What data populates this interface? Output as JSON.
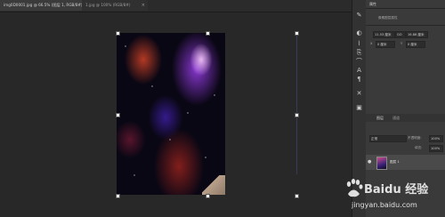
{
  "tabs": [
    {
      "label": "img0D0001.jpg @ 66.5% (图层 1, RGB/8#)",
      "close": "×"
    },
    {
      "label": "1.jpg @ 100% (RGB/8#)",
      "close": "×"
    }
  ],
  "properties": {
    "tab_label": "属性",
    "title": "像素图层属性",
    "w_value": "11.53 厘米",
    "link_label": "GO",
    "h_value": "16.88 厘米",
    "x_label": "X",
    "x_value": "0 厘米",
    "y_label": "Y",
    "y_value": "0 厘米"
  },
  "layers": {
    "tab_layers": "图层",
    "tab_channels": "通道",
    "mode": "正常",
    "opacity_label": "不透明度:",
    "opacity_value": "100%",
    "fill_label": "填充:",
    "fill_value": "100%",
    "layer_name": "图层 1"
  },
  "watermark": {
    "brand": "Baidu 经验",
    "url": "jingyan.baidu.com"
  },
  "icons": [
    "pen-icon",
    "adjust-icon",
    "brush-icon",
    "clone-icon",
    "path-icon",
    "text-icon",
    "paragraph-icon",
    "tools-icon",
    "cube-icon"
  ],
  "colors": {
    "workspace": "#282828",
    "panel": "#3a3a3a"
  }
}
